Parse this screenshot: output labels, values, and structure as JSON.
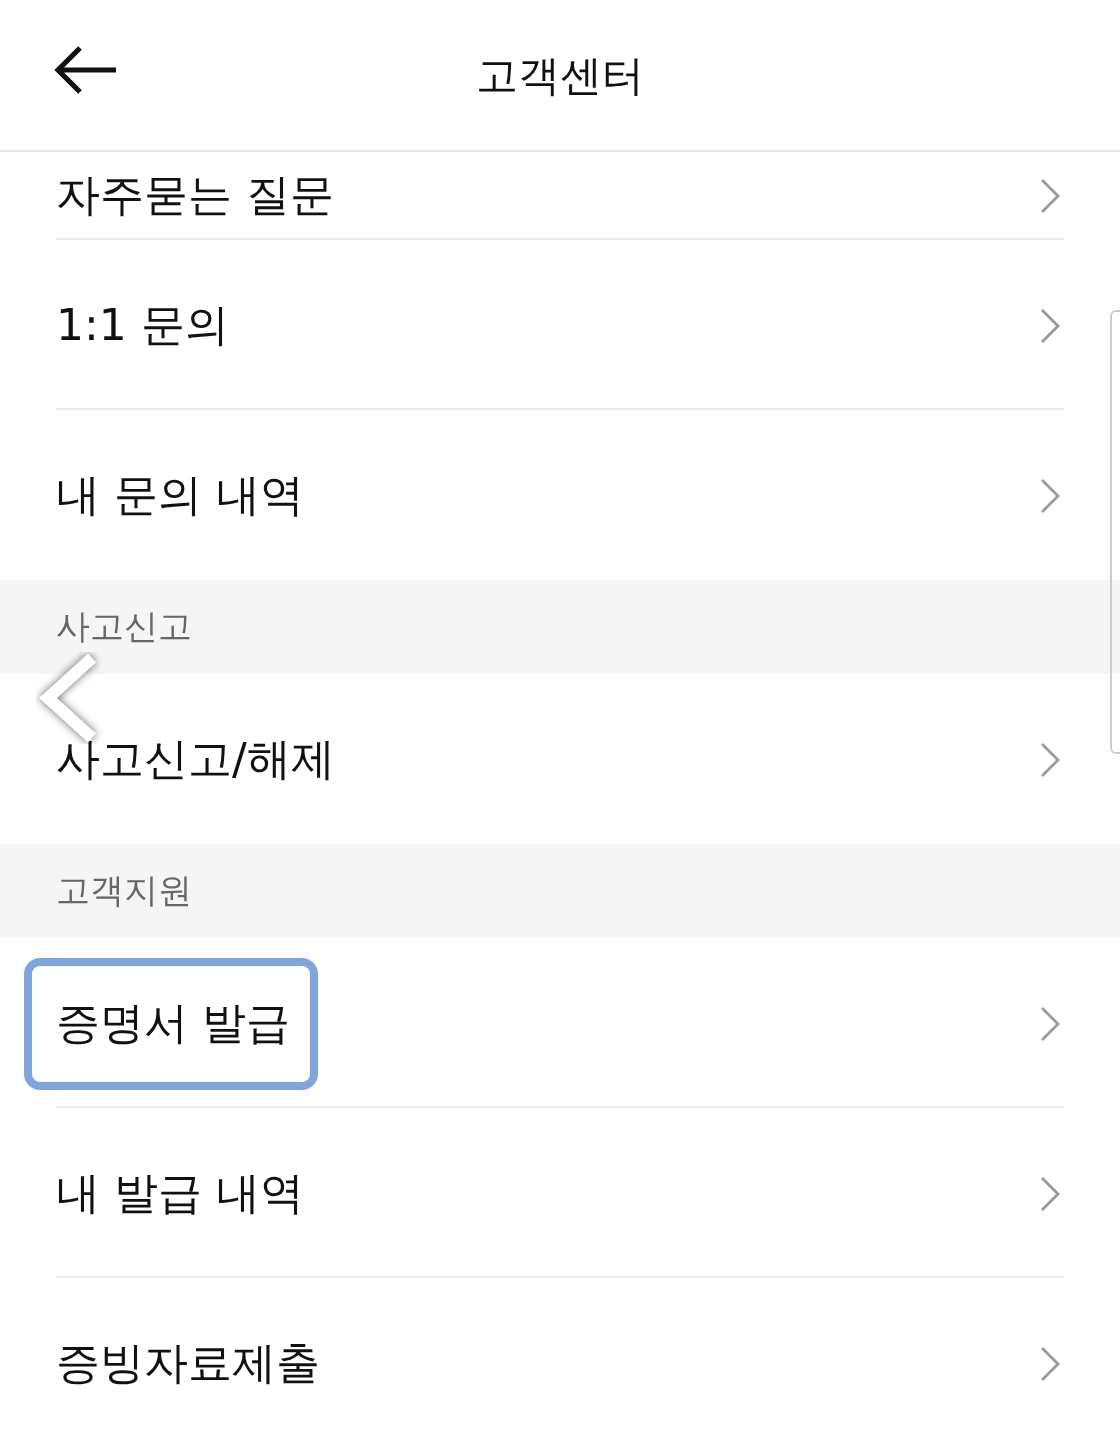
{
  "header": {
    "title": "고객센터"
  },
  "groups": [
    {
      "items": [
        {
          "label": "자주묻는 질문",
          "highlighted": false
        },
        {
          "label": "1:1 문의",
          "highlighted": false
        },
        {
          "label": "내 문의 내역",
          "highlighted": false
        }
      ]
    },
    {
      "heading": "사고신고",
      "items": [
        {
          "label": "사고신고/해제",
          "highlighted": false
        }
      ]
    },
    {
      "heading": "고객지원",
      "items": [
        {
          "label": "증명서 발급",
          "highlighted": true
        },
        {
          "label": "내 발급 내역",
          "highlighted": false
        },
        {
          "label": "증빙자료제출",
          "highlighted": false
        }
      ]
    }
  ]
}
